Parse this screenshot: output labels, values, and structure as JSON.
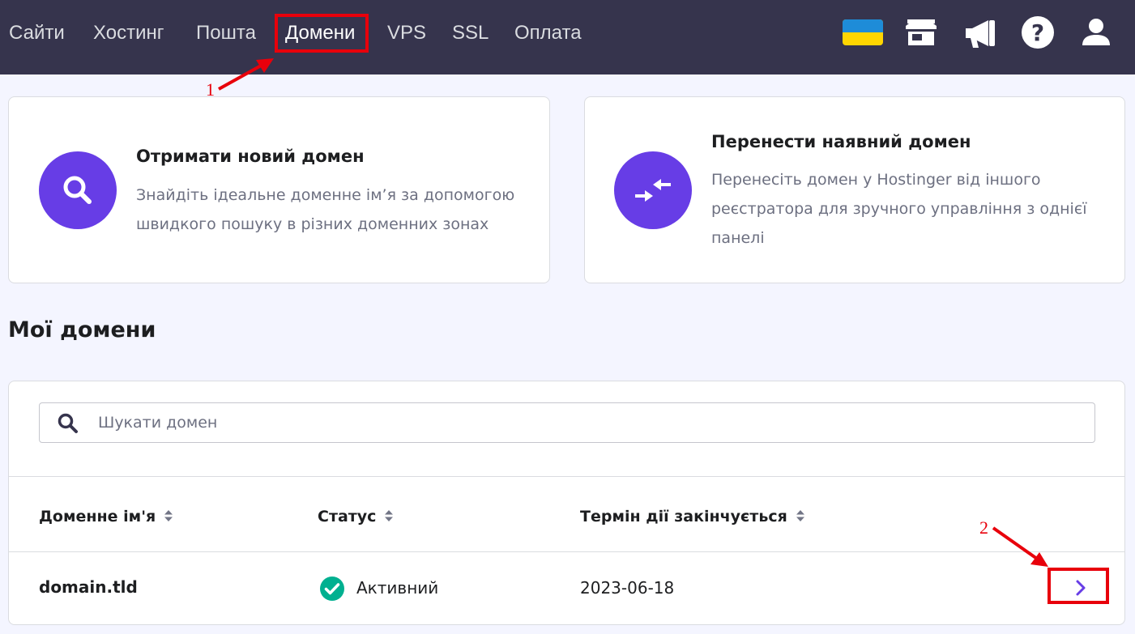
{
  "nav": {
    "items": [
      {
        "label": "Сайти"
      },
      {
        "label": "Хостинг"
      },
      {
        "label": "Пошта"
      },
      {
        "label": "Домени"
      },
      {
        "label": "VPS"
      },
      {
        "label": "SSL"
      },
      {
        "label": "Оплата"
      }
    ],
    "active_index": 3,
    "icons": [
      "ukraine-flag-icon",
      "store-icon",
      "megaphone-icon",
      "help-icon",
      "user-icon"
    ]
  },
  "annotations": {
    "step1": "1",
    "step2": "2"
  },
  "cards": {
    "new_domain": {
      "title": "Отримати новий домен",
      "description": "Знайдіть ідеальне доменне ім’я за допомогою швидкого пошуку в різних доменних зонах",
      "icon": "search-icon"
    },
    "transfer_domain": {
      "title": "Перенести наявний домен",
      "description": "Перенесіть домен у Hostinger від іншого реєстратора для зручного управління з однієї панелі",
      "icon": "transfer-arrows-icon"
    }
  },
  "domains": {
    "title": "Мої домени",
    "search_placeholder": "Шукати домен",
    "columns": [
      "Доменне ім'я",
      "Статус",
      "Термін дії закінчується"
    ],
    "rows": [
      {
        "name": "domain.tld",
        "status": "Активний",
        "expires": "2023-06-18"
      }
    ]
  },
  "colors": {
    "topbar": "#36344d",
    "accent": "#673de6",
    "success": "#00b090",
    "annotation": "#e8000b"
  }
}
